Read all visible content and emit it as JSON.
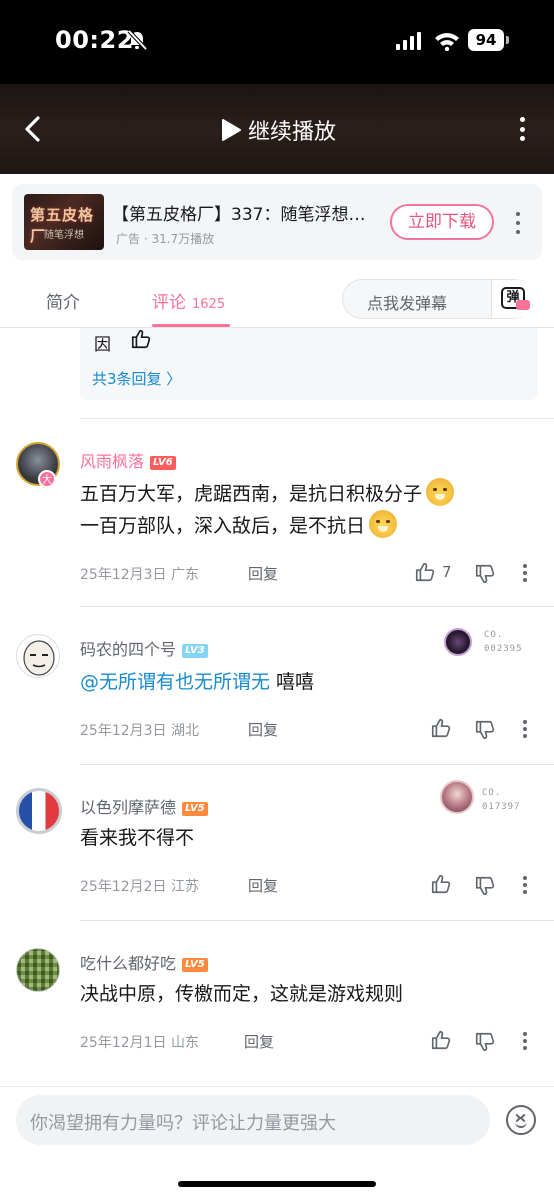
{
  "status": {
    "time": "00:22",
    "battery": "94"
  },
  "nav": {
    "title": "继续播放"
  },
  "ad": {
    "thumb_text_1": "第五皮格厂",
    "thumb_text_2": "随笔浮想",
    "title": "【第五皮格厂】337：随笔浮想…",
    "meta": "广告 · 31.7万播放",
    "download": "立即下载"
  },
  "tabs": {
    "intro": "简介",
    "comments": "评论",
    "comments_count": "1625",
    "danmaku_placeholder": "点我发弹幕",
    "danmaku_icon_char": "弹"
  },
  "prev_reply": {
    "text": "因",
    "more": "共3条回复 〉"
  },
  "comments": [
    {
      "user": "风雨枫落",
      "level": "LV6",
      "lines": [
        "五百万大军，虎踞西南，是抗日积极分子",
        "一百万部队，深入敌后，是不抗日"
      ],
      "date": "25年12月3日",
      "location": "广东",
      "reply": "回复",
      "likes": "7"
    },
    {
      "user": "码农的四个号",
      "level": "LV3",
      "mention": "@无所谓有也无所谓无",
      "text": " 嘻嘻",
      "date": "25年12月3日",
      "location": "湖北",
      "reply": "回复",
      "badge": [
        "CO.",
        "002395"
      ]
    },
    {
      "user": "以色列摩萨德",
      "level": "LV5",
      "text": "看来我不得不",
      "date": "25年12月2日",
      "location": "江苏",
      "reply": "回复",
      "badge": [
        "CO.",
        "017397"
      ]
    },
    {
      "user": "吃什么都好吃",
      "level": "LV5",
      "text": "决战中原，传檄而定，这就是游戏规则",
      "date": "25年12月1日",
      "location": "山东",
      "reply": "回复"
    }
  ],
  "input": {
    "placeholder": "你渴望拥有力量吗？评论让力量更强大"
  },
  "colors": {
    "accent": "#fb7299",
    "link": "#178bcf",
    "text": "#18191c",
    "secondary": "#9499a0"
  }
}
